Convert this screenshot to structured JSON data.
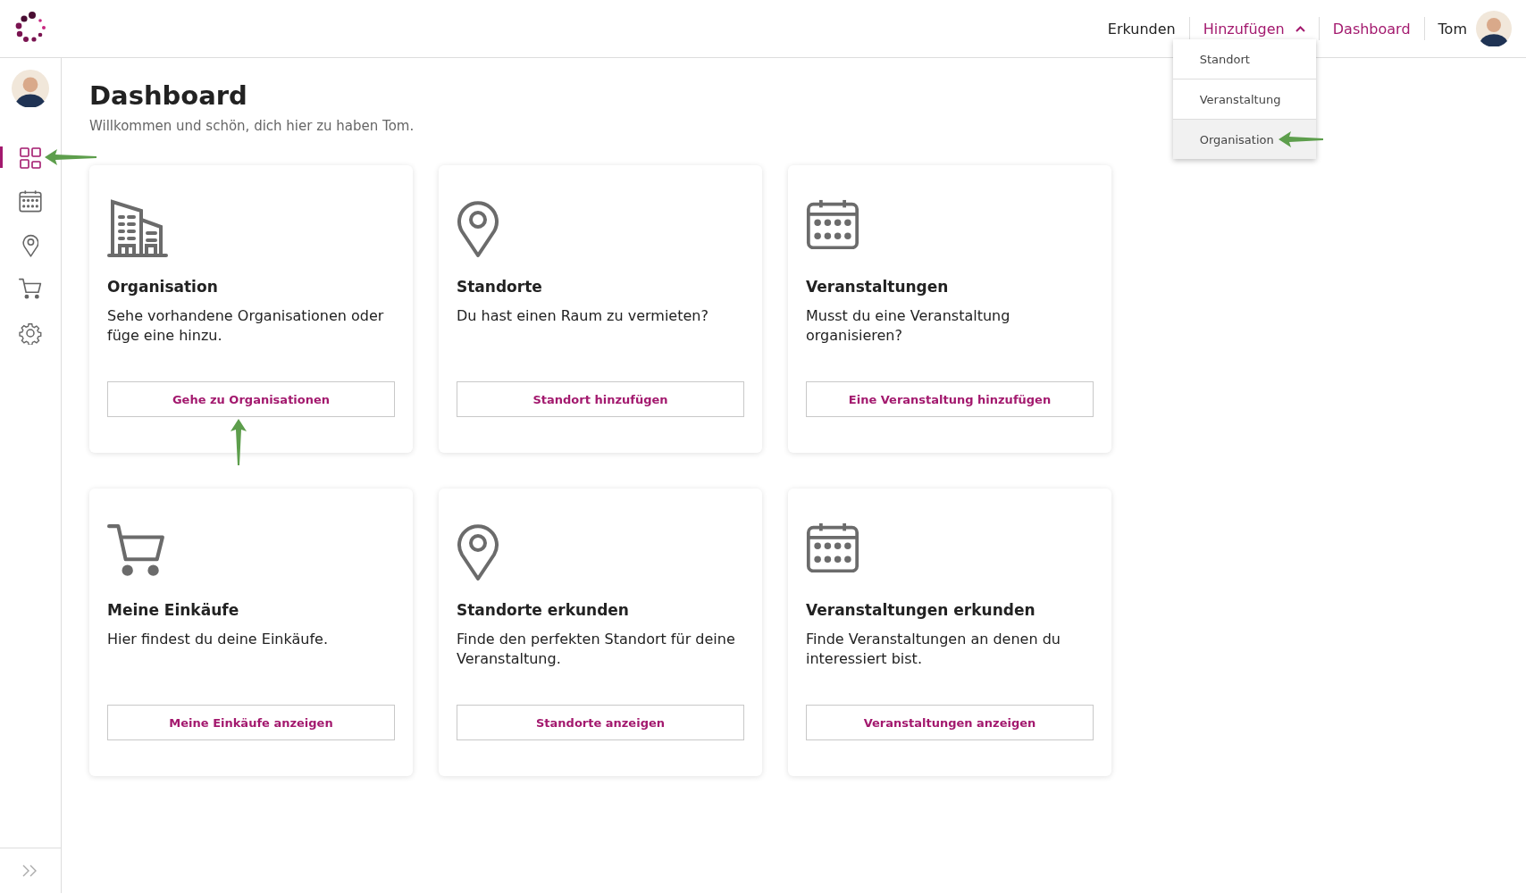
{
  "header": {
    "nav": [
      {
        "kind": "link",
        "label": "Erkunden",
        "selected": false
      },
      {
        "kind": "dropdown",
        "label": "Hinzufügen",
        "expanded": true,
        "menu": [
          {
            "label": "Standort",
            "selected": false,
            "annotated": false
          },
          {
            "label": "Veranstaltung",
            "selected": false,
            "annotated": false
          },
          {
            "label": "Organisation",
            "selected": true,
            "annotated": true
          }
        ]
      },
      {
        "kind": "link",
        "label": "Dashboard",
        "selected": true
      },
      {
        "kind": "user",
        "label": "Tom",
        "selected": false
      }
    ]
  },
  "sidebar": {
    "items": [
      {
        "kind": "grid",
        "selected": true,
        "annotated": true
      },
      {
        "kind": "calendar",
        "selected": false,
        "annotated": false
      },
      {
        "kind": "pin",
        "selected": false,
        "annotated": false
      },
      {
        "kind": "cart",
        "selected": false,
        "annotated": false
      },
      {
        "kind": "gear",
        "selected": false,
        "annotated": false
      }
    ]
  },
  "page": {
    "title": "Dashboard",
    "subtitle": "Willkommen und schön, dich hier zu haben Tom."
  },
  "cards": [
    {
      "kind": "building",
      "title": "Organisation",
      "text": "Sehe vorhandene Organisationen oder füge eine hinzu.",
      "button": "Gehe zu Organisationen",
      "annotated": true
    },
    {
      "kind": "pin",
      "title": "Standorte",
      "text": "Du hast einen Raum zu vermieten?",
      "button": "Standort hinzufügen",
      "annotated": false
    },
    {
      "kind": "calendar",
      "title": "Veranstaltungen",
      "text": "Musst du eine Veranstaltung organisieren?",
      "button": "Eine Veranstaltung hinzufügen",
      "annotated": false
    },
    {
      "kind": "cart",
      "title": "Meine Einkäufe",
      "text": "Hier findest du deine Einkäufe.",
      "button": "Meine Einkäufe anzeigen",
      "annotated": false
    },
    {
      "kind": "pin",
      "title": "Standorte erkunden",
      "text": "Finde den perfekten Standort für deine Veranstaltung.",
      "button": "Standorte anzeigen",
      "annotated": false
    },
    {
      "kind": "calendar",
      "title": "Veranstaltungen erkunden",
      "text": "Finde Veranstaltungen an denen du interessiert bist.",
      "button": "Veranstaltungen anzeigen",
      "annotated": false
    }
  ]
}
